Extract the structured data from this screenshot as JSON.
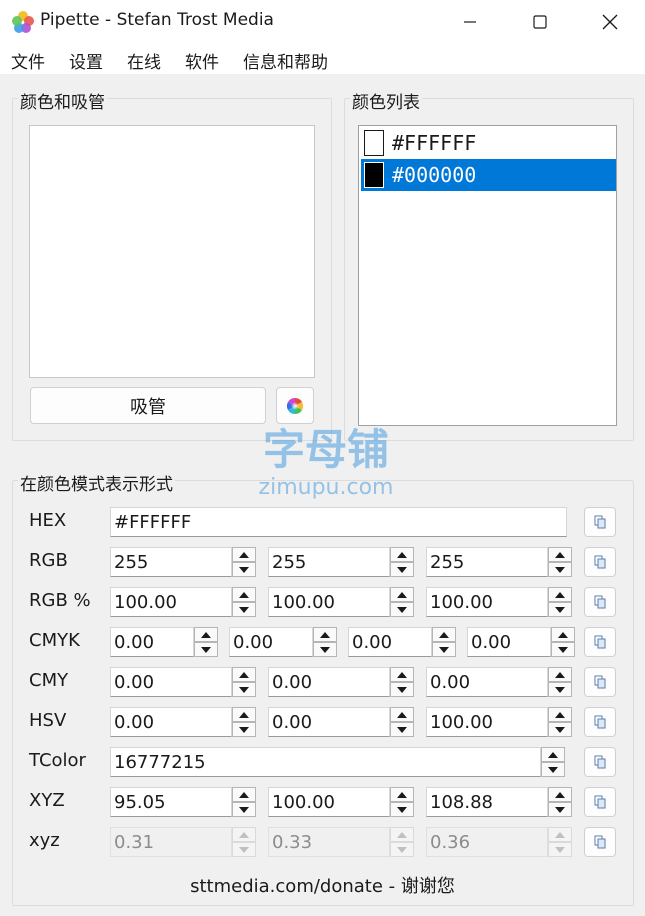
{
  "window": {
    "title": "Pipette - Stefan Trost Media"
  },
  "menu": [
    "文件",
    "设置",
    "在线",
    "软件",
    "信息和帮助"
  ],
  "color_picker": {
    "group_title": "颜色和吸管",
    "eyedropper_label": "吸管",
    "preview_color": "#FFFFFF"
  },
  "color_list": {
    "group_title": "颜色列表",
    "items": [
      {
        "label": "#FFFFFF",
        "color": "#FFFFFF",
        "selected": false
      },
      {
        "label": "#000000",
        "color": "#000000",
        "selected": true
      }
    ]
  },
  "models": {
    "group_title": "在颜色模式表示形式",
    "hex": {
      "label": "HEX",
      "value": "#FFFFFF"
    },
    "rgb": {
      "label": "RGB",
      "values": [
        "255",
        "255",
        "255"
      ]
    },
    "rgb_pct": {
      "label": "RGB %",
      "values": [
        "100.00",
        "100.00",
        "100.00"
      ]
    },
    "cmyk": {
      "label": "CMYK",
      "values": [
        "0.00",
        "0.00",
        "0.00",
        "0.00"
      ]
    },
    "cmy": {
      "label": "CMY",
      "values": [
        "0.00",
        "0.00",
        "0.00"
      ]
    },
    "hsv": {
      "label": "HSV",
      "values": [
        "0.00",
        "0.00",
        "100.00"
      ]
    },
    "tcolor": {
      "label": "TColor",
      "value": "16777215"
    },
    "xyz": {
      "label": "XYZ",
      "values": [
        "95.05",
        "100.00",
        "108.88"
      ]
    },
    "xyz_small": {
      "label": "xyz",
      "values": [
        "0.31",
        "0.33",
        "0.36"
      ]
    }
  },
  "footer": "sttmedia.com/donate - 谢谢您",
  "watermark": {
    "cn": "字母铺",
    "en": "zimupu.com"
  },
  "colors": {
    "selection": "#0078d7",
    "watermark": "#4a9de0"
  }
}
